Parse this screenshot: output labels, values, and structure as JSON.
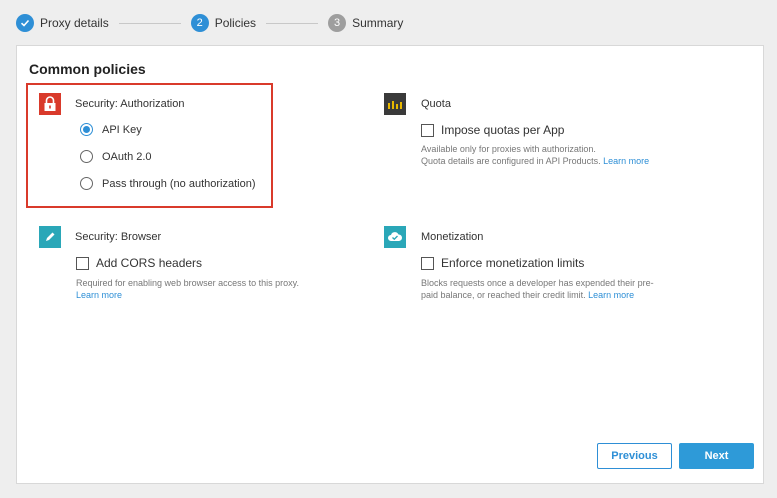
{
  "stepper": {
    "steps": [
      {
        "number": "✓",
        "label": "Proxy details",
        "state": "done"
      },
      {
        "number": "2",
        "label": "Policies",
        "state": "active"
      },
      {
        "number": "3",
        "label": "Summary",
        "state": "pending"
      }
    ]
  },
  "panel": {
    "title": "Common policies",
    "authorization": {
      "title": "Security: Authorization",
      "icon": "lock-icon",
      "options": [
        "API Key",
        "OAuth 2.0",
        "Pass through (no authorization)"
      ],
      "selected": "API Key"
    },
    "quota": {
      "title": "Quota",
      "icon": "bar-chart-icon",
      "checkbox_label": "Impose quotas per App",
      "help_line1": "Available only for proxies with authorization.",
      "help_line2": "Quota details are configured in API Products.",
      "link": "Learn more"
    },
    "browser": {
      "title": "Security: Browser",
      "icon": "pencil-icon",
      "checkbox_label": "Add CORS headers",
      "help_line1": "Required for enabling web browser access to this proxy.",
      "link": "Learn more"
    },
    "monetization": {
      "title": "Monetization",
      "icon": "monetization-cloud-icon",
      "checkbox_label": "Enforce monetization limits",
      "help_line1": "Blocks requests once a developer has expended their pre-",
      "help_line2": "paid balance, or reached their credit limit.",
      "link": "Learn more"
    }
  },
  "buttons": {
    "previous": "Previous",
    "next": "Next"
  },
  "colors": {
    "accent": "#2e8fd6",
    "highlight_border": "#d93a2b",
    "lock_icon_bg": "#d93a2b",
    "quota_icon_bg": "#3a3a3a",
    "browser_icon_bg": "#2aa7b8",
    "monetization_icon_bg": "#2aa7b8"
  }
}
